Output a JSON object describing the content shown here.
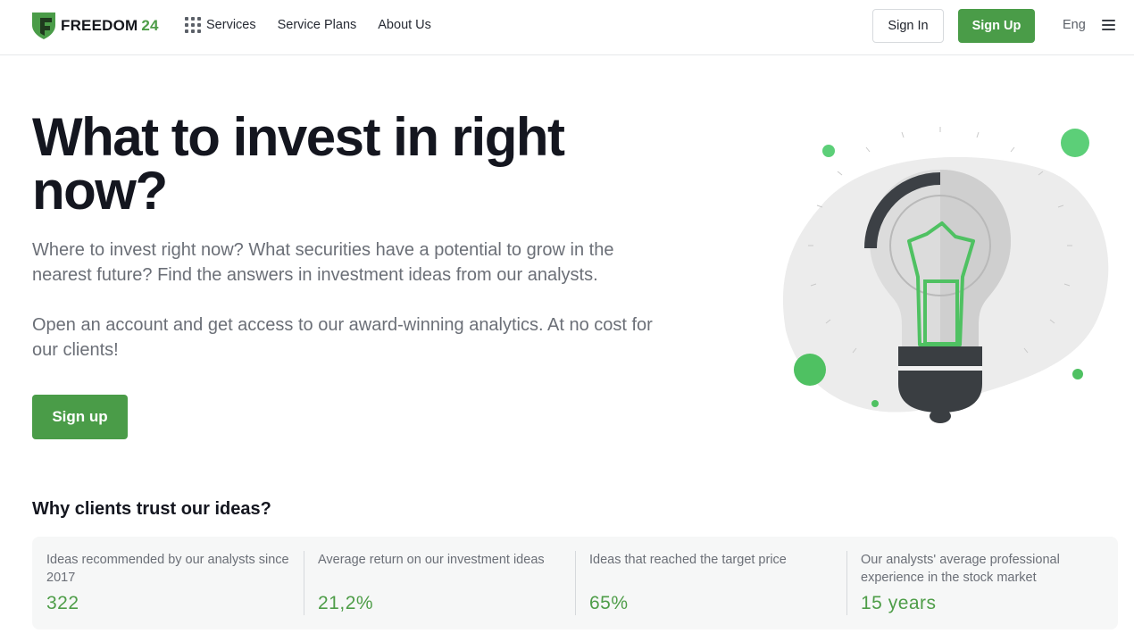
{
  "header": {
    "logo_text": "FREEDOM",
    "logo_number": "24",
    "nav": [
      "Services",
      "Service Plans",
      "About Us"
    ],
    "sign_in": "Sign In",
    "sign_up": "Sign Up",
    "language": "Eng"
  },
  "hero": {
    "title": "What to invest in right now?",
    "paragraph1": "Where to invest right now? What securities have a potential to grow in the nearest future? Find the answers in investment ideas from our analysts.",
    "paragraph2": "Open an account and get access to our award-winning analytics. At no cost for our clients!",
    "cta": "Sign up"
  },
  "trust": {
    "title": "Why clients trust our ideas?",
    "stats": [
      {
        "label": "Ideas recommended by our analysts since 2017",
        "value": "322"
      },
      {
        "label": "Average return on our investment ideas",
        "value": "21,2%"
      },
      {
        "label": "Ideas that reached the target price",
        "value": "65%"
      },
      {
        "label": "Our analysts' average professional experience in the stock market",
        "value": "15 years"
      }
    ]
  },
  "colors": {
    "brand_green": "#4a9c48",
    "text_dark": "#14161f",
    "text_muted": "#6b6f77"
  },
  "icons": [
    "logo-shield-icon",
    "apps-grid-icon",
    "menu-burger-icon",
    "lightbulb-illustration"
  ]
}
